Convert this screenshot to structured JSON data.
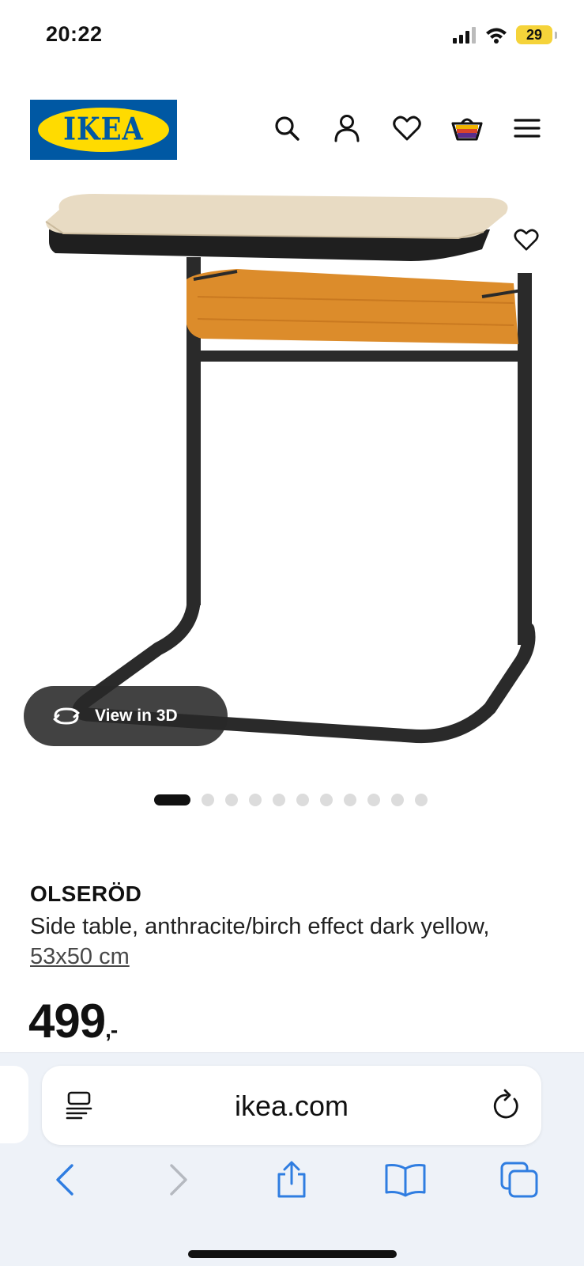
{
  "status_bar": {
    "time": "20:22",
    "battery": "29"
  },
  "header": {
    "logo": "IKEA"
  },
  "product": {
    "view_3d_label": "View in 3D",
    "carousel": {
      "count": 11,
      "active": 0
    },
    "name": "OLSERÖD",
    "description": "Side table, anthracite/birch effect dark yellow,",
    "size": "53x50 cm",
    "price": "499",
    "price_suffix": ",-"
  },
  "browser": {
    "url": "ikea.com"
  },
  "icons": {
    "search": "search-icon",
    "account": "user-icon",
    "wishlist": "heart-icon",
    "cart": "basket-icon",
    "menu": "hamburger-menu-icon"
  },
  "colors": {
    "ikea_blue": "#0058a3",
    "ikea_yellow": "#ffdb00",
    "ios_blue": "#2f7de1"
  }
}
